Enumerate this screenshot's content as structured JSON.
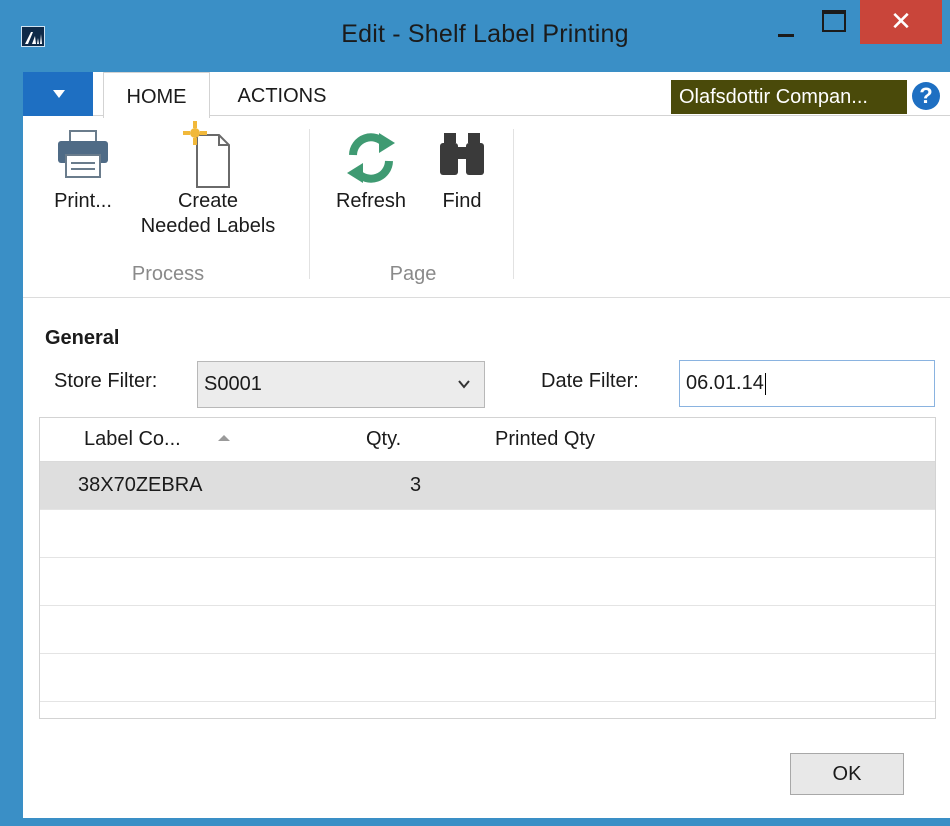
{
  "window": {
    "title": "Edit - Shelf Label Printing",
    "close_glyph": "✕"
  },
  "ribbon": {
    "tabs": [
      {
        "label": "HOME",
        "active": true
      },
      {
        "label": "ACTIONS",
        "active": false
      }
    ],
    "company": "Olafsdottir Compan...",
    "help_glyph": "?",
    "groups": [
      {
        "label": "Process",
        "buttons": [
          {
            "label": "Print...",
            "icon": "printer-icon"
          },
          {
            "label_line1": "Create",
            "label_line2": "Needed Labels",
            "icon": "new-document-icon"
          }
        ]
      },
      {
        "label": "Page",
        "buttons": [
          {
            "label": "Refresh",
            "icon": "refresh-icon"
          },
          {
            "label": "Find",
            "icon": "binoculars-icon"
          }
        ]
      }
    ]
  },
  "general": {
    "title": "General",
    "store_filter_label": "Store Filter:",
    "store_filter_value": "S0001",
    "date_filter_label": "Date Filter:",
    "date_filter_value": "06.01.14"
  },
  "grid": {
    "columns": [
      "Label Co...",
      "Qty.",
      "Printed Qty"
    ],
    "rows": [
      {
        "label_code": "38X70ZEBRA",
        "qty": "3",
        "printed_qty": ""
      }
    ]
  },
  "footer": {
    "ok_label": "OK"
  },
  "colors": {
    "frame": "#3a8fc6",
    "close": "#c9453a",
    "app_menu": "#1e6fc2",
    "company_badge": "#4a4a0a",
    "refresh_green": "#3f9a72"
  }
}
